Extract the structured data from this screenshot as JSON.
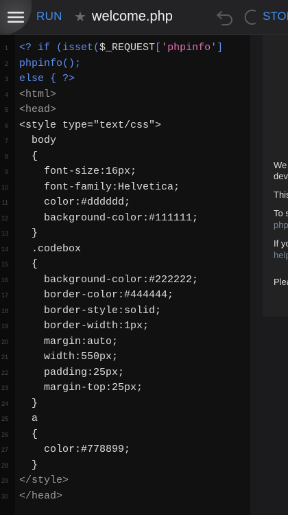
{
  "toolbar": {
    "menu_icon": "hamburger-menu-icon",
    "run_label": "RUN",
    "star_icon": "star-icon",
    "file_name": "welcome.php",
    "undo_icon": "undo-icon",
    "redo_icon": "redo-icon",
    "stop_label": "STOP",
    "accent_color": "#3d8ff0"
  },
  "editor": {
    "lines": [
      {
        "n": "1",
        "code": "<? if (isset($_REQUEST['phpinfo']"
      },
      {
        "n": "2",
        "code": "phpinfo();"
      },
      {
        "n": "3",
        "code": "else { ?>"
      },
      {
        "n": "4",
        "code": "<html>"
      },
      {
        "n": "5",
        "code": "<head>"
      },
      {
        "n": "6",
        "code": "<style type=\"text/css\">"
      },
      {
        "n": "7",
        "code": "  body"
      },
      {
        "n": "8",
        "code": "  {"
      },
      {
        "n": "9",
        "code": "    font-size:16px;"
      },
      {
        "n": "10",
        "code": "    font-family:Helvetica;"
      },
      {
        "n": "11",
        "code": "    color:#dddddd;"
      },
      {
        "n": "12",
        "code": "    background-color:#111111;"
      },
      {
        "n": "13",
        "code": "  }"
      },
      {
        "n": "14",
        "code": "  .codebox"
      },
      {
        "n": "15",
        "code": "  {"
      },
      {
        "n": "16",
        "code": "    background-color:#222222;"
      },
      {
        "n": "17",
        "code": "    border-color:#444444;"
      },
      {
        "n": "18",
        "code": "    border-style:solid;"
      },
      {
        "n": "19",
        "code": "    border-width:1px;"
      },
      {
        "n": "20",
        "code": "    margin:auto;"
      },
      {
        "n": "21",
        "code": "    width:550px;"
      },
      {
        "n": "22",
        "code": "    padding:25px;"
      },
      {
        "n": "23",
        "code": "    margin-top:25px;"
      },
      {
        "n": "24",
        "code": "  }"
      },
      {
        "n": "25",
        "code": "  a"
      },
      {
        "n": "26",
        "code": "  {"
      },
      {
        "n": "27",
        "code": "    color:#778899;"
      },
      {
        "n": "28",
        "code": "  }"
      },
      {
        "n": "29",
        "code": "</style>"
      },
      {
        "n": "30",
        "code": "</head>"
      }
    ]
  },
  "preview": {
    "texts": [
      {
        "text": "We",
        "link": false
      },
      {
        "text": "dev",
        "link": false
      },
      {
        "text": "This",
        "link": false
      },
      {
        "text": "To s",
        "link": false
      },
      {
        "text": "php",
        "link": true
      },
      {
        "text": "If yo",
        "link": false
      },
      {
        "text": "help",
        "link": true
      },
      {
        "text": "Plea",
        "link": false
      }
    ]
  }
}
